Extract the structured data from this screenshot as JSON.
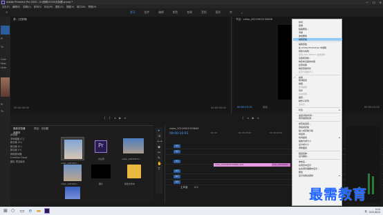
{
  "title_bar": {
    "app_title": "Adobe Premiere Pro 2020 - D:\\视频\\2020\\无标题.prproj *",
    "controls": [
      "—",
      "☐",
      "✕"
    ]
  },
  "menu_bar": {
    "items": [
      "文件(F)",
      "编辑(E)",
      "剪辑(C)",
      "序列(S)",
      "标记(M)",
      "图形(G)",
      "视图(V)",
      "窗口(W)",
      "帮助(H)"
    ]
  },
  "workspace_tabs": {
    "items": [
      "学习",
      "组件",
      "编辑",
      "颜色",
      "效果",
      "音频",
      "图形",
      "库"
    ],
    "active_index": 0,
    "more": "»"
  },
  "left_strip": {
    "texts": [
      "Pr",
      "Tu",
      "Com",
      "New",
      "Here",
      "Pr",
      "Tu"
    ]
  },
  "source_panel": {
    "tab": "源：(无剪辑)",
    "timecode_left": "00:00:00:00",
    "timecode_right": "00:00:00:00"
  },
  "program_panel": {
    "tab": "节目：video_20210615150846",
    "timecode_left": "00:00:10:01",
    "timecode_right": "00:00:10:02",
    "fit": "适合"
  },
  "project_panel": {
    "tabs": [
      "媒体浏览器",
      "项目：无标题"
    ],
    "folder_label": "收藏夹",
    "tree": [
      "此电脑",
      "本地磁盘 (C:)",
      "新加卷 (D:)",
      "新加卷 (E:)",
      "新加卷 (F:)",
      "网络驱动器",
      "Creative Cloud",
      "团队 项目版本"
    ],
    "thumbs": [
      {
        "label": "video_2021061..."
      },
      {
        "label": "好主意"
      },
      {
        "label": "video_20210615..."
      },
      {
        "label": "video_2021061..."
      },
      {
        "label": "图片"
      },
      {
        "label": "新建文件夹"
      },
      {
        "label": ""
      }
    ]
  },
  "timeline": {
    "tab": "video_20210615150846",
    "timecode": "00:00:10:01",
    "ruler_marks": [
      "00:00",
      "00:00:05:00",
      "00:00:10:00"
    ],
    "video_tracks": [
      "V3",
      "V2",
      "V1"
    ],
    "audio_tracks": [
      "A1",
      "A2",
      "A3"
    ],
    "master_label": "主声道",
    "master_value": "0.0",
    "clip_a_label": "video_20210615150846.mp4",
    "clip_b_label": "video_20210615..."
  },
  "context_menu": {
    "items": [
      {
        "label": "剪切",
        "state": "normal"
      },
      {
        "label": "复制",
        "state": "normal"
      },
      {
        "label": "粘贴属性...",
        "state": "normal"
      },
      {
        "label": "清除",
        "state": "normal"
      },
      {
        "label": "波纹删除",
        "state": "normal"
      },
      {
        "label": "编辑原始",
        "state": "highlight"
      },
      {
        "label": "",
        "state": "separator"
      },
      {
        "label": "编辑原始",
        "state": "normal"
      },
      {
        "label": "在 Adobe Photoshop 中编辑",
        "state": "normal"
      },
      {
        "label": "替换为剪辑",
        "state": "normal"
      },
      {
        "label": "使用 After Effects 合成替换",
        "state": "disabled"
      },
      {
        "label": "渲染和替换...",
        "state": "normal"
      },
      {
        "label": "恢复未渲染的内容",
        "state": "normal"
      },
      {
        "label": "还原剪辑",
        "state": "normal"
      },
      {
        "label": "恢复原始时长",
        "state": "normal"
      },
      {
        "label": "还原为原始大小",
        "state": "disabled"
      },
      {
        "label": "",
        "state": "separator"
      },
      {
        "label": "启用",
        "state": "checked"
      },
      {
        "label": "取消链接",
        "state": "normal"
      },
      {
        "label": "编组",
        "state": "normal"
      },
      {
        "label": "取消编组",
        "state": "disabled"
      },
      {
        "label": "同步",
        "state": "normal"
      },
      {
        "label": "合并剪辑...",
        "state": "disabled"
      },
      {
        "label": "嵌套...",
        "state": "normal"
      },
      {
        "label": "制作子序列",
        "state": "normal"
      },
      {
        "label": "多机位",
        "state": "disabled"
      },
      {
        "label": "",
        "state": "separator"
      },
      {
        "label": "标签",
        "state": "submenu"
      },
      {
        "label": "",
        "state": "separator"
      },
      {
        "label": "速度/持续时间...",
        "state": "normal"
      },
      {
        "label": "场景编辑检测...",
        "state": "normal"
      },
      {
        "label": "",
        "state": "separator"
      },
      {
        "label": "帧定格选项...",
        "state": "normal"
      },
      {
        "label": "添加帧定格",
        "state": "normal"
      },
      {
        "label": "插入帧定格分段",
        "state": "normal"
      },
      {
        "label": "场选项...",
        "state": "normal"
      },
      {
        "label": "时间插值",
        "state": "submenu"
      },
      {
        "label": "缩放为帧大小",
        "state": "normal"
      },
      {
        "label": "设为帧大小",
        "state": "normal"
      },
      {
        "label": "调整图层",
        "state": "normal"
      },
      {
        "label": "",
        "state": "separator"
      },
      {
        "label": "链接媒体...",
        "state": "normal"
      },
      {
        "label": "设为脱机...",
        "state": "normal"
      },
      {
        "label": "",
        "state": "separator"
      },
      {
        "label": "重命名...",
        "state": "normal"
      },
      {
        "label": "在项目中显示",
        "state": "normal"
      },
      {
        "label": "在资源管理器中显示...",
        "state": "normal"
      },
      {
        "label": "属性",
        "state": "normal"
      },
      {
        "label": "显示剪辑关键帧",
        "state": "submenu"
      }
    ]
  },
  "watermark": "最需教育",
  "taskbar": {
    "tray_text": "英",
    "time": "9:34",
    "date": "2021/6/24"
  },
  "colors": {
    "accent_blue": "#4aa3ff",
    "menu_highlight": "#91c9f7",
    "clip_pink": "#e79be0",
    "watermark_blue": "#1e63ff"
  }
}
